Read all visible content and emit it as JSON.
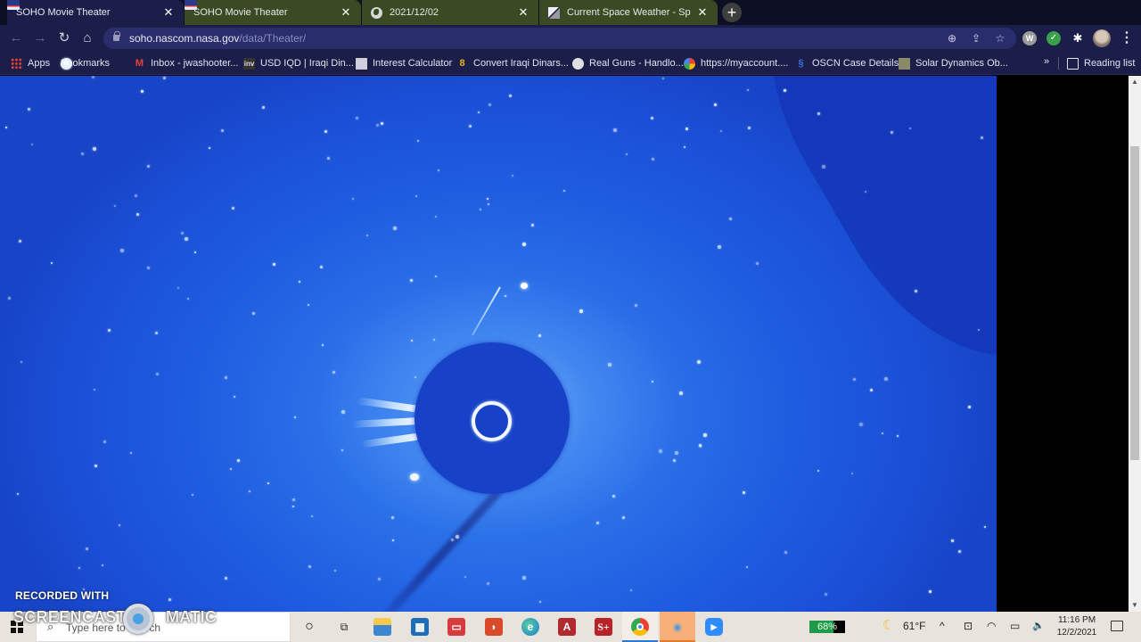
{
  "browser": {
    "tabs": [
      {
        "title": "SOHO Movie Theater",
        "favicon": "soho-icon",
        "active": true
      },
      {
        "title": "SOHO Movie Theater",
        "favicon": "soho-icon",
        "active": false
      },
      {
        "title": "2021/12/02",
        "favicon": "globe-icon",
        "active": false
      },
      {
        "title": "Current Space Weather - Space V",
        "favicon": "space-weather-icon",
        "active": false
      }
    ],
    "close_glyph": "✕",
    "new_tab_glyph": "+",
    "url_host": "soho.nascom.nasa.gov",
    "url_path": "/data/Theater/",
    "nav": {
      "back": "←",
      "forward": "→",
      "reload": "↻",
      "home": "⌂"
    },
    "omnibox_icons": {
      "zoom": "⊕",
      "share": "⇪",
      "bookmark": "☆"
    },
    "extensions": {
      "w": "W",
      "check": "✓",
      "puzzle": "✱",
      "menu": "⋮"
    },
    "bookmarks": [
      {
        "label": "Apps",
        "icon": "apps-icon"
      },
      {
        "label": "Bookmarks",
        "icon": "star-icon"
      },
      {
        "label": "Inbox - jwashooter...",
        "icon": "gmail-icon"
      },
      {
        "label": "USD IQD | Iraqi Din...",
        "icon": "inv-icon"
      },
      {
        "label": "Interest Calculator",
        "icon": "calculator-icon"
      },
      {
        "label": "Convert Iraqi Dinars...",
        "icon": "convert-icon"
      },
      {
        "label": "Real Guns - Handlo...",
        "icon": "globe-icon"
      },
      {
        "label": "https://myaccount....",
        "icon": "google-icon"
      },
      {
        "label": "OSCN Case Details",
        "icon": "oscn-icon"
      },
      {
        "label": "Solar Dynamics Ob...",
        "icon": "sdo-icon"
      }
    ],
    "bookmarks_overflow": "»",
    "reading_list": "Reading list"
  },
  "page": {
    "image_description": "SOHO LASCO C3 coronagraph view with occulting disk and sun outline",
    "scroll_up": "▲",
    "scroll_down": "▼"
  },
  "watermark": {
    "line1": "RECORDED WITH",
    "line2": "SCREENCAST",
    "line3": "MATIC"
  },
  "taskbar": {
    "search_placeholder": "Type here to search",
    "search_icon": "⌕",
    "apps": [
      {
        "name": "cortana",
        "glyph": "○"
      },
      {
        "name": "task-view",
        "glyph": "⧉"
      },
      {
        "name": "file-explorer",
        "glyph": "▬"
      },
      {
        "name": "microsoft-store",
        "glyph": "▦"
      },
      {
        "name": "reader",
        "glyph": "▭"
      },
      {
        "name": "app-red-face",
        "glyph": "◗"
      },
      {
        "name": "edge",
        "glyph": "e"
      },
      {
        "name": "access",
        "glyph": "A"
      },
      {
        "name": "scrabble-app",
        "glyph": "S+"
      },
      {
        "name": "chrome",
        "glyph": "●"
      },
      {
        "name": "screencast-o-matic",
        "glyph": "◉"
      },
      {
        "name": "zoom",
        "glyph": "▶"
      }
    ],
    "battery_percent": 68,
    "battery_label": "68%",
    "weather_temp": "61°F",
    "weather_icon": "☾",
    "tray": {
      "chevron": "^",
      "meet": "⊡",
      "wifi": "◠",
      "battery": "▭",
      "volume": "🔈"
    },
    "time": "11:16 PM",
    "date": "12/2/2021"
  },
  "colors": {
    "tab_bar": "#0d0f24",
    "toolbar": "#1c1e4a",
    "tab_group": "#3b4a23",
    "coronagraph_blue": "#2a6fe8",
    "occulter": "#1742c8",
    "taskbar": "#e8e3dc",
    "battery_green": "#1f9a4a"
  }
}
